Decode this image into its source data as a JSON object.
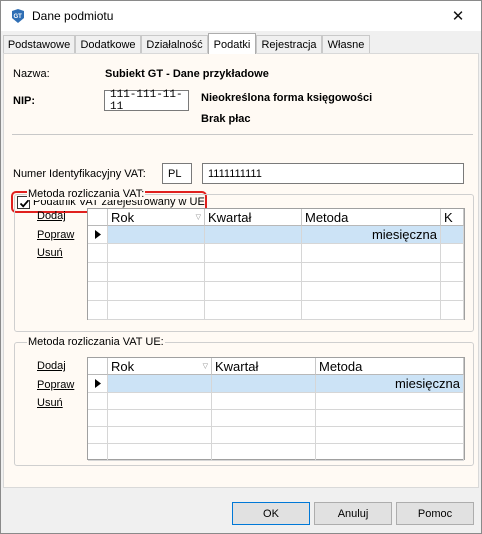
{
  "window": {
    "title": "Dane podmiotu"
  },
  "tabs": [
    {
      "label": "Podstawowe"
    },
    {
      "label": "Dodatkowe"
    },
    {
      "label": "Działalność"
    },
    {
      "label": "Podatki"
    },
    {
      "label": "Rejestracja"
    },
    {
      "label": "Własne"
    }
  ],
  "active_tab": "Podatki",
  "company": {
    "name_label": "Nazwa:",
    "name_value": "Subiekt GT - Dane przykładowe",
    "nip_label": "NIP:",
    "nip_value": "111-111-11-11",
    "legal_form": "Nieokreślona forma księgowości",
    "payroll": "Brak płac"
  },
  "vat_eu": {
    "checkbox_label": "Podatnik VAT zarejestrowany w UE",
    "checked": true,
    "id_label": "Numer Identyfikacyjny VAT:",
    "country_code": "PL",
    "id_value": "1111111111"
  },
  "vat_method": {
    "title": "Metoda rozliczania VAT:",
    "actions": {
      "add": "Dodaj",
      "edit": "Popraw",
      "remove": "Usuń"
    },
    "columns": [
      "Rok",
      "Kwartał",
      "Metoda",
      "K"
    ],
    "rows": [
      {
        "rok": "",
        "kwartal": "",
        "metoda": "miesięczna"
      }
    ]
  },
  "vat_ue_method": {
    "title": "Metoda rozliczania VAT UE:",
    "actions": {
      "add": "Dodaj",
      "edit": "Popraw",
      "remove": "Usuń"
    },
    "columns": [
      "Rok",
      "Kwartał",
      "Metoda"
    ],
    "rows": [
      {
        "rok": "",
        "kwartal": "",
        "metoda": "miesięczna"
      }
    ]
  },
  "buttons": {
    "ok": "OK",
    "cancel": "Anuluj",
    "help": "Pomoc"
  },
  "colors": {
    "highlight_border": "#e0201e",
    "selected_row": "#cce3f6",
    "panel_bg": "#fffaf4"
  }
}
